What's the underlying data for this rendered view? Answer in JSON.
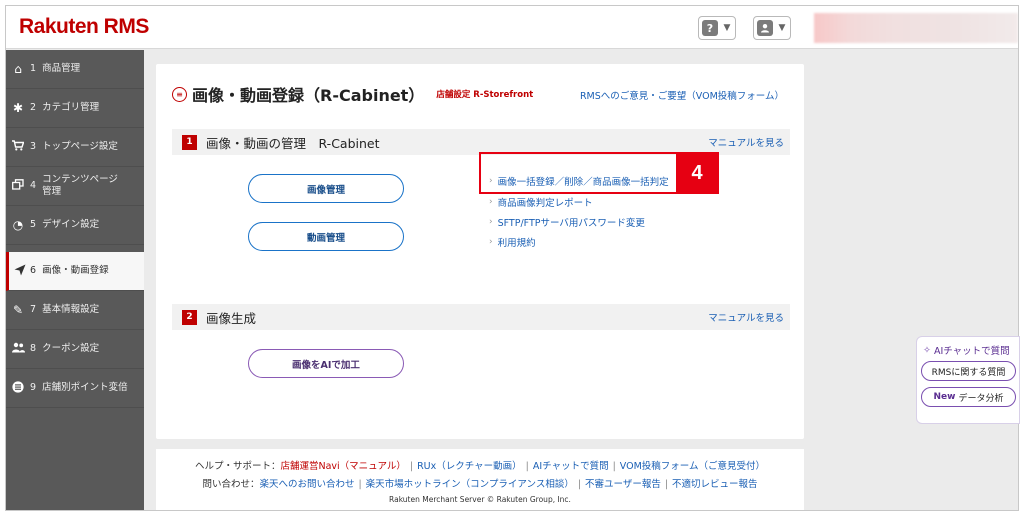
{
  "header": {
    "logo": "Rakuten RMS",
    "help_icon": "?",
    "account_icon": "user-icon"
  },
  "sidebar": {
    "items": [
      {
        "num": "1",
        "label": "商品管理",
        "icon": "home-icon"
      },
      {
        "num": "2",
        "label": "カテゴリ管理",
        "icon": "gear-icon"
      },
      {
        "num": "3",
        "label": "トップページ設定",
        "icon": "cart-icon"
      },
      {
        "num": "4",
        "label": "コンテンツページ\n管理",
        "icon": "pages-icon"
      },
      {
        "num": "5",
        "label": "デザイン設定",
        "icon": "palette-icon"
      },
      {
        "num": "6",
        "label": "画像・動画登録",
        "icon": "send-icon",
        "active": true
      },
      {
        "num": "7",
        "label": "基本情報設定",
        "icon": "wrench-icon"
      },
      {
        "num": "8",
        "label": "クーポン設定",
        "icon": "people-icon"
      },
      {
        "num": "9",
        "label": "店舗別ポイント変倍",
        "icon": "list-icon"
      }
    ]
  },
  "main": {
    "title": "画像・動画登録（R-Cabinet）",
    "store_badge": "店舗設定 R-Storefront",
    "feedback_link": "RMSへのご意見・ご要望（VOM投稿フォーム）",
    "sections": [
      {
        "num": "1",
        "title": "画像・動画の管理　R-Cabinet",
        "manual": "マニュアルを見る",
        "buttons": [
          "画像管理",
          "動画管理"
        ],
        "links": [
          "画像一括登録／削除／商品画像一括判定",
          "商品画像判定レポート",
          "SFTP/FTPサーバ用パスワード変更",
          "利用規約"
        ]
      },
      {
        "num": "2",
        "title": "画像生成",
        "manual": "マニュアルを見る",
        "buttons": [
          "画像をAIで加工"
        ]
      }
    ],
    "step_badge": "4"
  },
  "footer": {
    "help_label": "ヘルプ・サポート：",
    "help_links": [
      "店舗運営Navi（マニュアル）",
      "RUx（レクチャー動画）",
      "AIチャットで質問",
      "VOM投稿フォーム（ご意見受付）"
    ],
    "contact_label": "問い合わせ：",
    "contact_links": [
      "楽天へのお問い合わせ",
      "楽天市場ホットライン（コンプライアンス相談）",
      "不審ユーザー報告",
      "不適切レビュー報告"
    ],
    "copyright": "Rakuten Merchant Server © Rakuten Group, Inc."
  },
  "ai_widget": {
    "title": "AIチャットで質問",
    "btn_rms": "RMSに関する質問",
    "btn_new_tag": "New",
    "btn_new_label": "データ分析"
  },
  "colors": {
    "brand": "#bf0000",
    "link": "#1a5fb4",
    "highlight": "#e60012",
    "sidebar_bg": "#595959",
    "ai_accent": "#5a2d91"
  }
}
